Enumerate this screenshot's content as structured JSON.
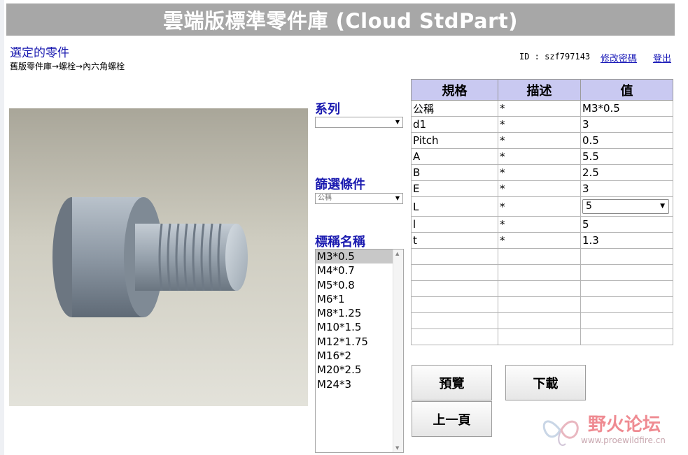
{
  "header": {
    "title": "雲端版標準零件庫 (Cloud StdPart)"
  },
  "selected": {
    "title": "選定的零件",
    "breadcrumb": "舊版零件庫→螺栓→內六角螺栓"
  },
  "user": {
    "id_text": "ID : szf797143",
    "change_password": "修改密碼",
    "logout": "登出"
  },
  "series": {
    "label": "系列",
    "value": ""
  },
  "filter": {
    "label": "篩選條件",
    "value": "公稱"
  },
  "nominal": {
    "label": "標稱名稱",
    "items": [
      "M3*0.5",
      "M4*0.7",
      "M5*0.8",
      "M6*1",
      "M8*1.25",
      "M10*1.5",
      "M12*1.75",
      "M16*2",
      "M20*2.5",
      "M24*3"
    ],
    "selected_index": 0
  },
  "table": {
    "headers": [
      "規格",
      "描述",
      "值"
    ],
    "rows": [
      {
        "spec": "公稱",
        "desc": "*",
        "value": "M3*0.5"
      },
      {
        "spec": "d1",
        "desc": "*",
        "value": "3"
      },
      {
        "spec": "Pitch",
        "desc": "*",
        "value": "0.5"
      },
      {
        "spec": "A",
        "desc": "*",
        "value": "5.5"
      },
      {
        "spec": "B",
        "desc": "*",
        "value": "2.5"
      },
      {
        "spec": "E",
        "desc": "*",
        "value": "3"
      },
      {
        "spec": "L",
        "desc": "*",
        "value": "5"
      },
      {
        "spec": "l",
        "desc": "*",
        "value": "5"
      },
      {
        "spec": "t",
        "desc": "*",
        "value": "1.3"
      }
    ]
  },
  "buttons": {
    "preview": "預覽",
    "download": "下載",
    "back": "上一頁"
  },
  "watermark": {
    "text": "野火论坛",
    "url": "www.proewildfire.cn"
  }
}
